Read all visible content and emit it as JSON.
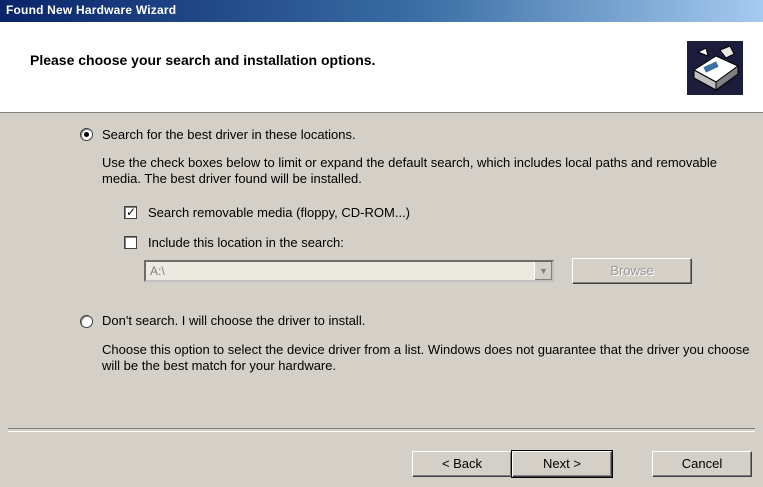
{
  "window": {
    "title": "Found New Hardware Wizard"
  },
  "header": {
    "title": "Please choose your search and installation options.",
    "icon": "hardware-wizard-icon"
  },
  "options": {
    "search": {
      "label": "Search for the best driver in these locations.",
      "selected": true,
      "description": "Use the check boxes below to limit or expand the default search, which includes local paths and removable media. The best driver found will be installed.",
      "removable_media": {
        "label": "Search removable media (floppy, CD-ROM...)",
        "checked": true
      },
      "include_location": {
        "label": "Include this location in the search:",
        "checked": false,
        "path_value": "A:\\",
        "browse_label": "Browse"
      }
    },
    "dont_search": {
      "label": "Don't search. I will choose the driver to install.",
      "selected": false,
      "description": "Choose this option to select the device driver from a list. Windows does not guarantee that the driver you choose will be the best match for your hardware."
    }
  },
  "footer": {
    "back_label": "< Back",
    "next_label": "Next >",
    "cancel_label": "Cancel"
  }
}
